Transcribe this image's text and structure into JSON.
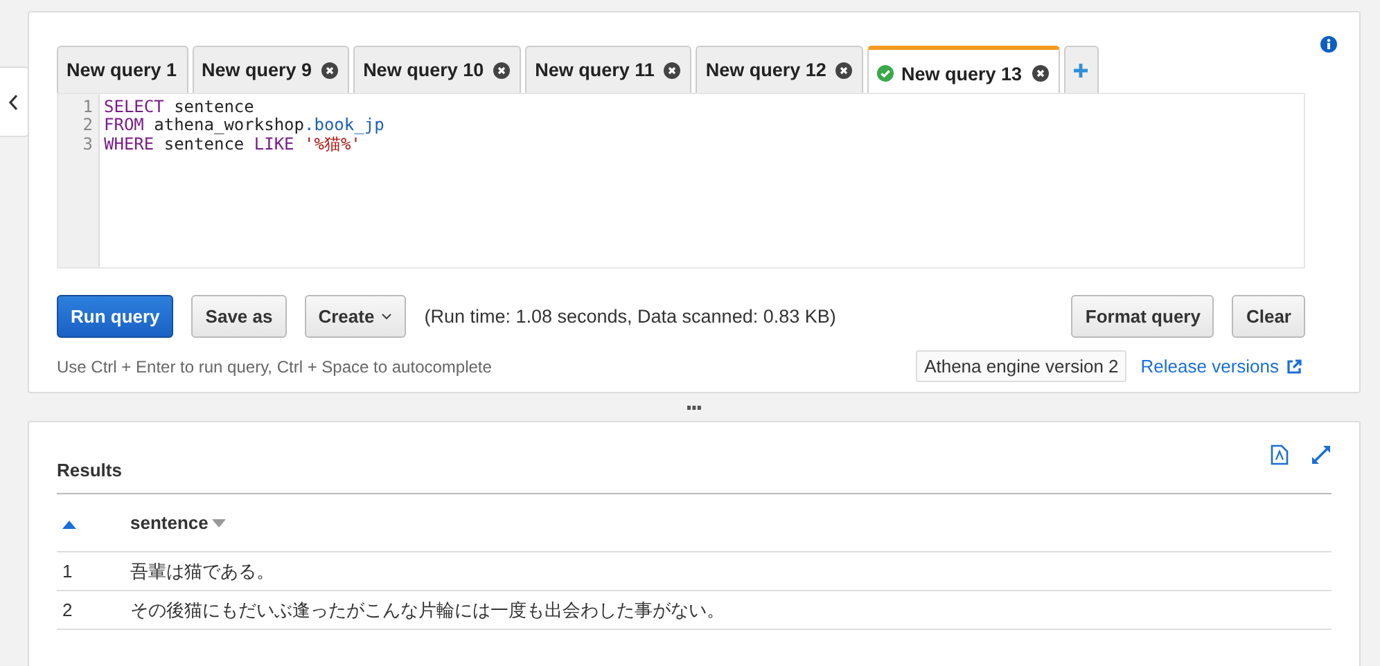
{
  "tabs": [
    {
      "label": "New query 1",
      "selected": false,
      "closable": false,
      "succeeded": false
    },
    {
      "label": "New query 9",
      "selected": false,
      "closable": true,
      "succeeded": false
    },
    {
      "label": "New query 10",
      "selected": false,
      "closable": true,
      "succeeded": false
    },
    {
      "label": "New query 11",
      "selected": false,
      "closable": true,
      "succeeded": false
    },
    {
      "label": "New query 12",
      "selected": false,
      "closable": true,
      "succeeded": false
    },
    {
      "label": "New query 13",
      "selected": true,
      "closable": true,
      "succeeded": true
    }
  ],
  "editor": {
    "lines": [
      {
        "number": "1",
        "tokens": [
          {
            "text": "SELECT",
            "kind": "keyword"
          },
          {
            "text": " sentence",
            "kind": "plain"
          }
        ]
      },
      {
        "number": "2",
        "tokens": [
          {
            "text": "FROM",
            "kind": "keyword"
          },
          {
            "text": " athena_workshop",
            "kind": "plain"
          },
          {
            "text": ".book_jp",
            "kind": "qualifier"
          }
        ]
      },
      {
        "number": "3",
        "tokens": [
          {
            "text": "WHERE",
            "kind": "keyword"
          },
          {
            "text": " sentence ",
            "kind": "plain"
          },
          {
            "text": "LIKE",
            "kind": "keyword"
          },
          {
            "text": " '%猫%'",
            "kind": "string"
          }
        ]
      }
    ]
  },
  "actions": [
    {
      "label": "Run query",
      "kind": "primary"
    },
    {
      "label": "Save as",
      "kind": "plain"
    },
    {
      "label": "Create",
      "kind": "dropdown"
    }
  ],
  "run_info": "(Run time: 1.08 seconds, Data scanned: 0.83 KB)",
  "right_actions": [
    {
      "label": "Format query"
    },
    {
      "label": "Clear"
    }
  ],
  "hint": "Use Ctrl + Enter to run query, Ctrl + Space to autocomplete",
  "engine_badge": "Athena engine version 2",
  "release_link": "Release versions",
  "results": {
    "title": "Results",
    "columns": [
      {
        "label": "sentence"
      }
    ],
    "rows": [
      {
        "index": "1",
        "sentence": "吾輩は猫である。"
      },
      {
        "index": "2",
        "sentence": "その後猫にもだいぶ逢ったがこんな片輪には一度も出会わした事がない。"
      }
    ]
  }
}
